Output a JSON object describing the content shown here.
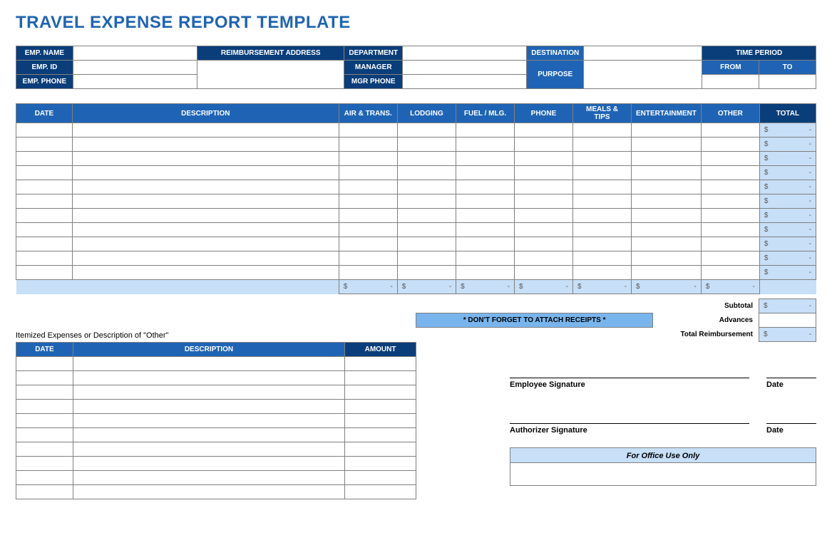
{
  "title": "TRAVEL EXPENSE REPORT TEMPLATE",
  "header": {
    "emp_name_label": "EMP. NAME",
    "emp_id_label": "EMP. ID",
    "emp_phone_label": "EMP. PHONE",
    "reimb_addr_label": "REIMBURSEMENT ADDRESS",
    "department_label": "DEPARTMENT",
    "manager_label": "MANAGER",
    "mgr_phone_label": "MGR PHONE",
    "destination_label": "DESTINATION",
    "purpose_label": "PURPOSE",
    "time_period_label": "TIME PERIOD",
    "from_label": "FROM",
    "to_label": "TO",
    "emp_name": "",
    "emp_id": "",
    "emp_phone": "",
    "reimb_addr": "",
    "department": "",
    "manager": "",
    "mgr_phone": "",
    "destination": "",
    "purpose": "",
    "from": "",
    "to": ""
  },
  "expense_columns": {
    "date": "DATE",
    "description": "DESCRIPTION",
    "air_trans": "AIR & TRANS.",
    "lodging": "LODGING",
    "fuel_mlg": "FUEL / MLG.",
    "phone": "PHONE",
    "meals_tips": "MEALS & TIPS",
    "entertainment": "ENTERTAINMENT",
    "other": "OTHER",
    "total": "TOTAL"
  },
  "totals": {
    "dollar": "$",
    "dash": "-",
    "subtotal_label": "Subtotal",
    "advances_label": "Advances",
    "total_reimb_label": "Total Reimbursement"
  },
  "receipts_note": "* DON'T FORGET TO ATTACH RECEIPTS *",
  "itemized": {
    "heading": "Itemized Expenses or Description of \"Other\"",
    "date_label": "DATE",
    "description_label": "DESCRIPTION",
    "amount_label": "AMOUNT"
  },
  "signatures": {
    "employee": "Employee Signature",
    "authorizer": "Authorizer Signature",
    "date": "Date"
  },
  "office_use": "For Office Use Only"
}
